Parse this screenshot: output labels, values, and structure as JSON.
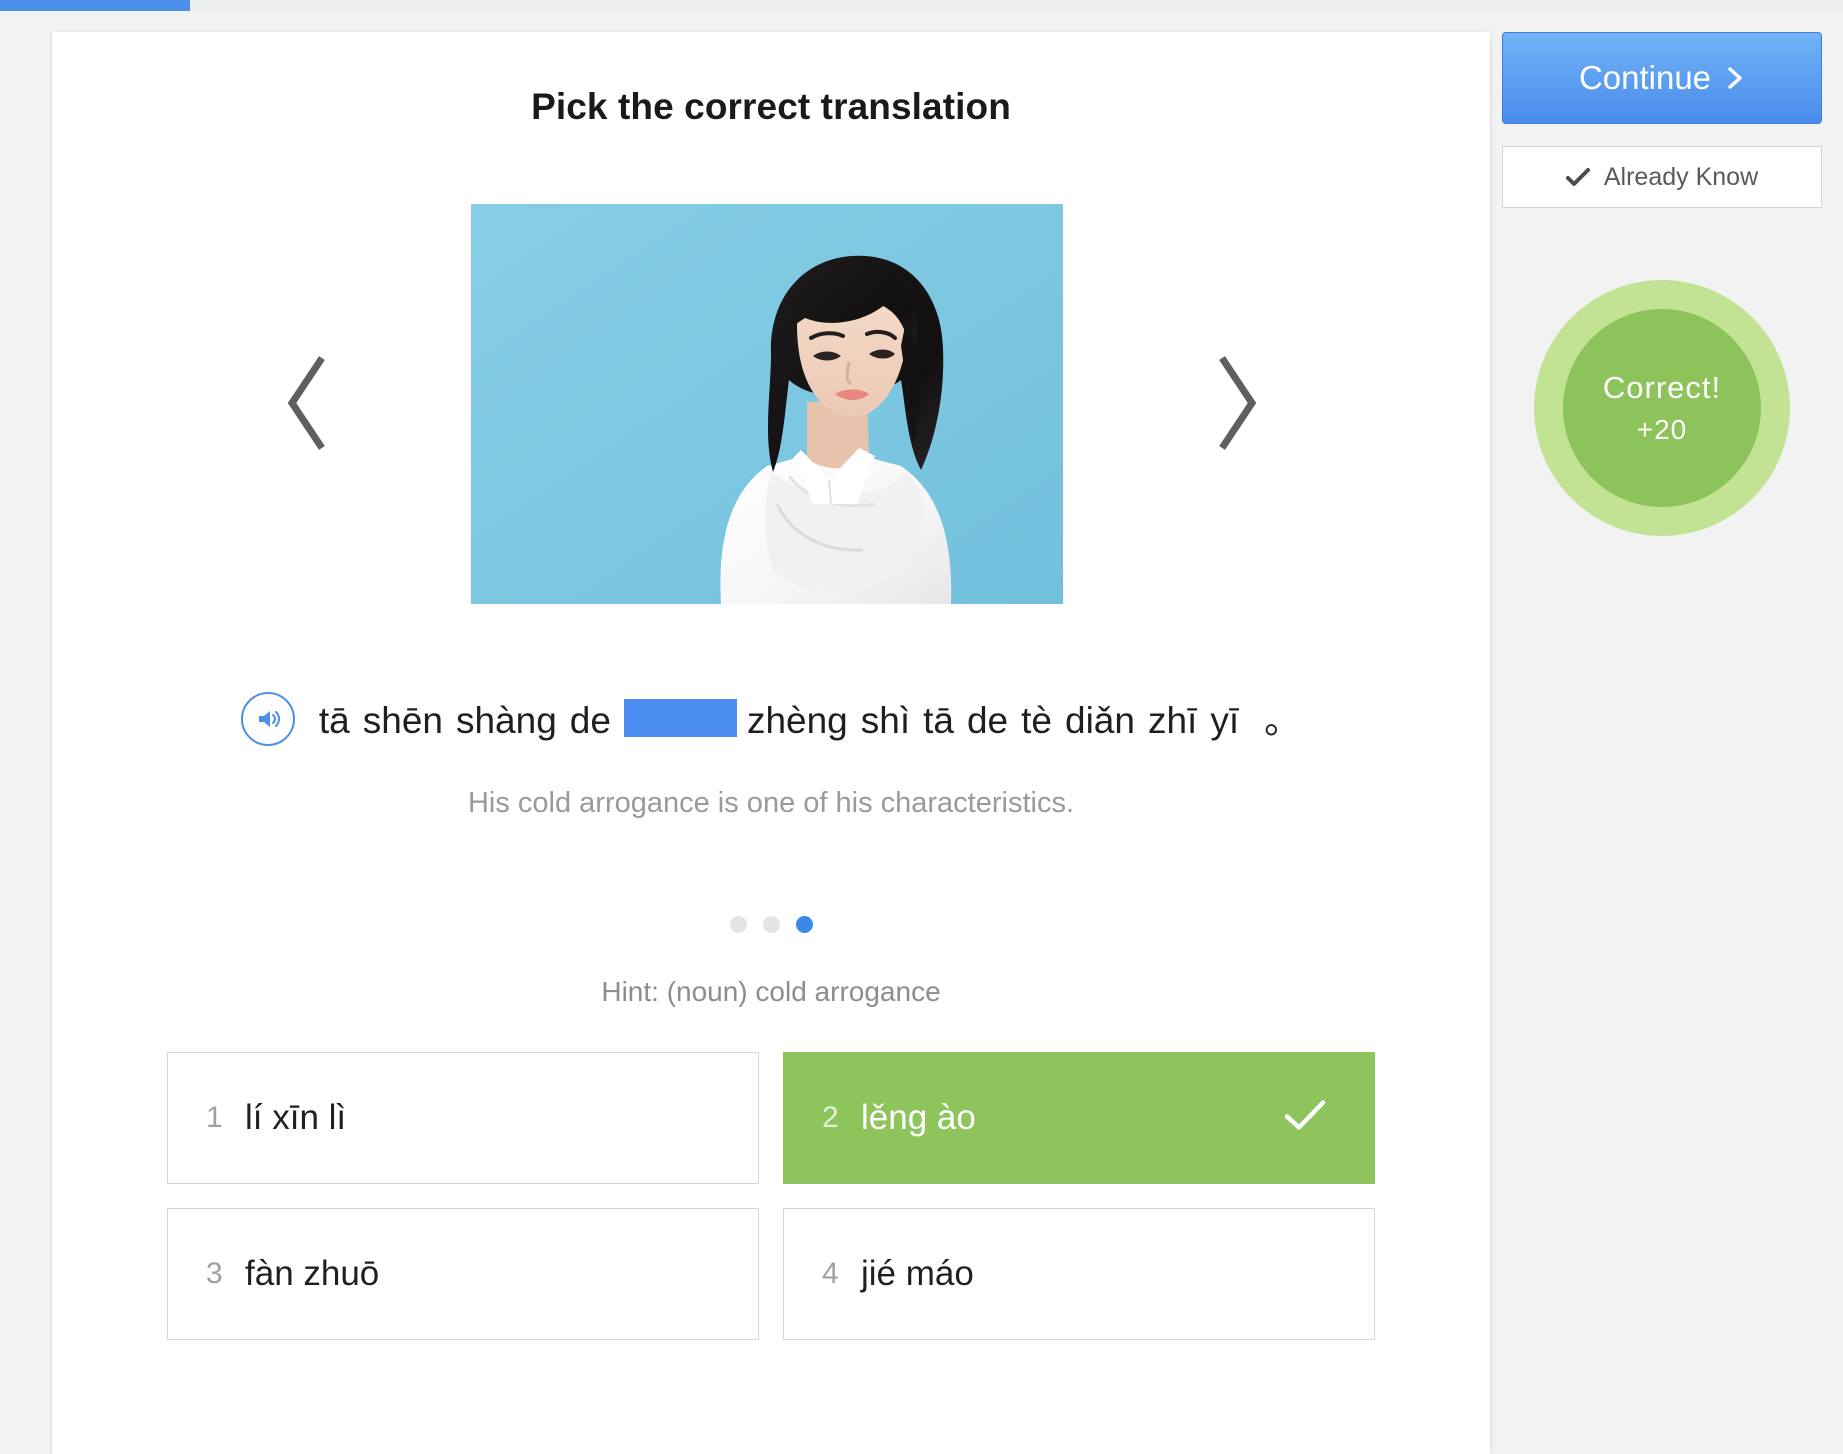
{
  "progress": {
    "percent": 10.3
  },
  "card": {
    "title": "Pick the correct translation",
    "nav": {
      "prev_icon": "chevron-left-icon",
      "next_icon": "chevron-right-icon"
    },
    "image": {
      "alt": "Woman in white shirt with arms crossed on light blue background",
      "background_color": "#7ec9e2"
    },
    "sentence": {
      "audio_icon": "speaker-icon",
      "words_before": [
        "tā",
        "shēn",
        "shàng",
        "de"
      ],
      "blank": "",
      "words_after": [
        "zhèng",
        "shì",
        "tā",
        "de",
        "tè",
        "diǎn",
        "zhī",
        "yī"
      ],
      "punctuation": "。",
      "blank_color": "#4a8cf0"
    },
    "translation": "His cold arrogance is one of his characteristics.",
    "dots": {
      "count": 3,
      "active_index": 2
    },
    "hint": "Hint: (noun) cold arrogance",
    "options": [
      {
        "number": "1",
        "text": "lí xīn lì",
        "correct": false
      },
      {
        "number": "2",
        "text": "lěng ào",
        "correct": true
      },
      {
        "number": "3",
        "text": "fàn zhuō",
        "correct": false
      },
      {
        "number": "4",
        "text": "jié máo",
        "correct": false
      }
    ]
  },
  "side_panel": {
    "continue_label": "Continue",
    "continue_icon": "chevron-right-icon",
    "already_know_label": "Already Know",
    "already_know_icon": "check-icon",
    "score": {
      "label": "Correct!",
      "points": "+20",
      "ring_color": "#c3e394",
      "fill_color": "#8cc35a"
    }
  },
  "colors": {
    "accent_blue": "#4a90e8",
    "correct_green": "#8ec45c",
    "page_background": "#f2f2f2"
  }
}
